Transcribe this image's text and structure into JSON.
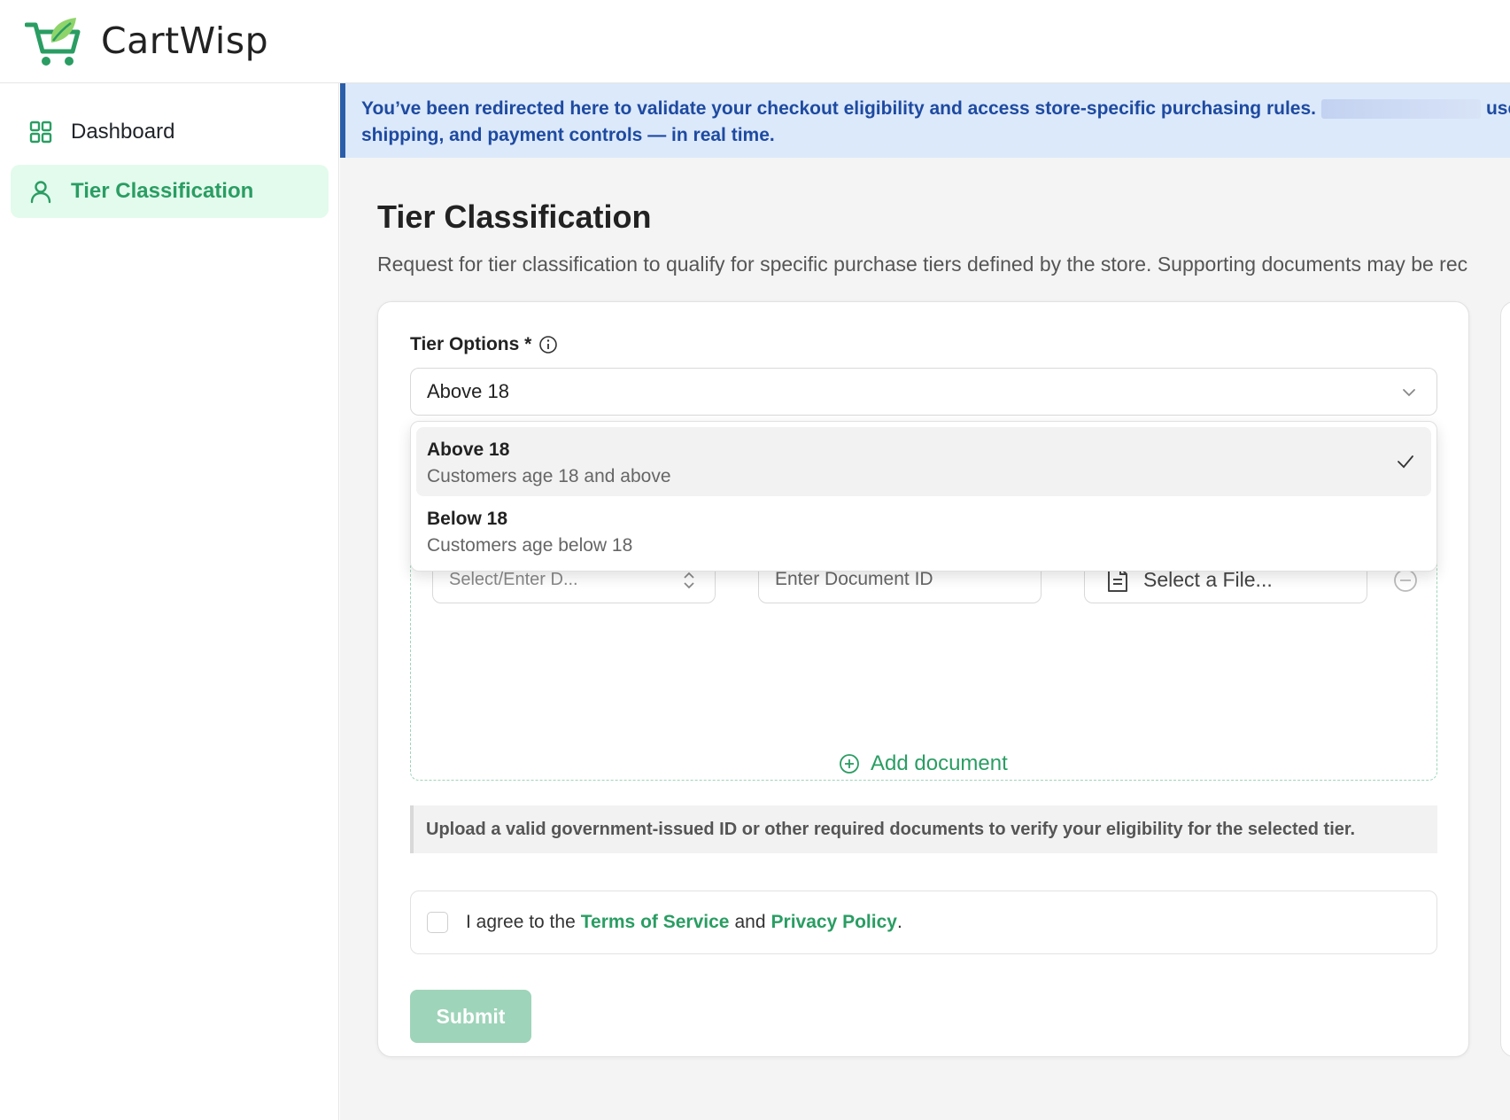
{
  "brand": {
    "name": "CartWisp",
    "accent": "#2a9d63"
  },
  "sidebar": {
    "items": [
      {
        "label": "Dashboard",
        "icon": "grid-icon",
        "active": false
      },
      {
        "label": "Tier Classification",
        "icon": "user-icon",
        "active": true
      }
    ]
  },
  "banner": {
    "text_before": "You’ve been redirected here to validate your checkout eligibility and access store-specific purchasing rules.",
    "text_after": "uses CartV",
    "line2": "shipping, and payment controls — in real time."
  },
  "page": {
    "title": "Tier Classification",
    "description": "Request for tier classification to qualify for specific purchase tiers defined by the store. Supporting documents may be rec"
  },
  "form": {
    "tier_label": "Tier Options",
    "required_mark": "*",
    "selected": "Above 18",
    "options": [
      {
        "title": "Above 18",
        "subtitle": "Customers age 18 and above",
        "selected": true
      },
      {
        "title": "Below 18",
        "subtitle": "Customers age below 18",
        "selected": false
      }
    ],
    "doc_type_placeholder": "Select/Enter D...",
    "doc_id_placeholder": "Enter Document ID",
    "file_label": "Select a File...",
    "add_document": "Add document",
    "note": "Upload a valid government-issued ID or other required documents to verify your eligibility for the selected tier.",
    "agree_prefix": "I agree to the",
    "terms": "Terms of Service",
    "and": "and",
    "privacy": "Privacy Policy",
    "period": ".",
    "submit": "Submit"
  }
}
